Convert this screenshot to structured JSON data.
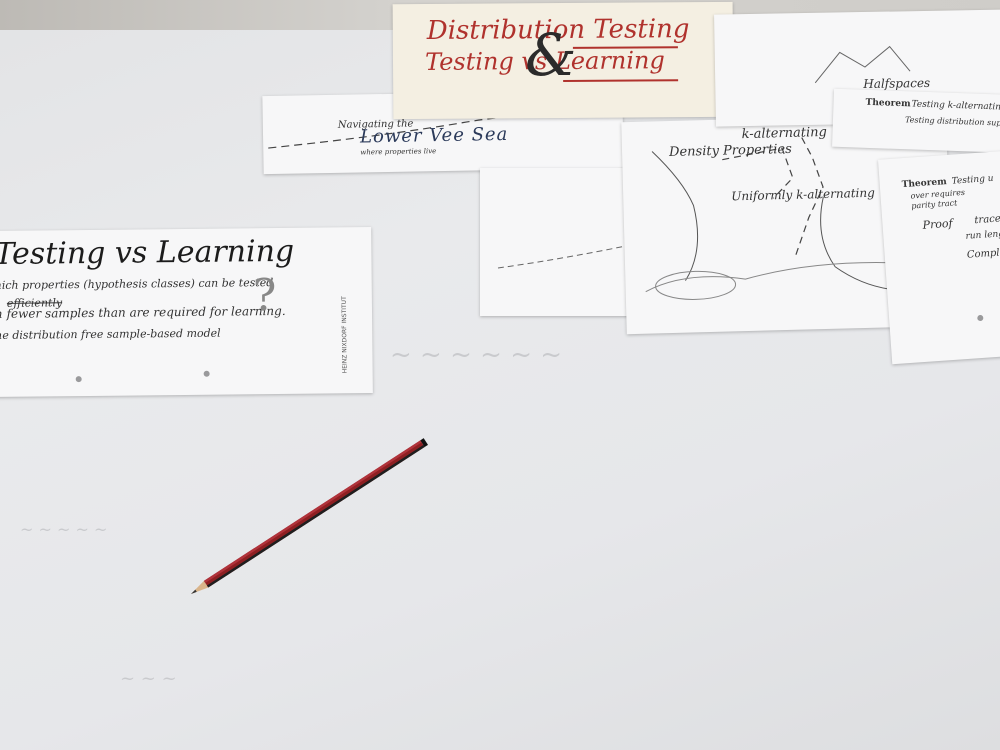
{
  "title_poster": {
    "line1": "Distribution Testing",
    "line2": "Testing vs Learning",
    "ampersand": "&"
  },
  "map_banner": {
    "top_text": "Navigating the",
    "title": "Lower Vee Sea",
    "subtitle": "where properties live"
  },
  "card_left": {
    "title": "Testing vs Learning",
    "line1": "hich properties (hypothesis classes) can be tested",
    "line2_struck": "efficiently",
    "line3": "h fewer samples than are required for learning.",
    "line4": "he distribution free sample-based model",
    "question_mark": "?",
    "side_label": "HEINZ NIXDORF INSTITUT"
  },
  "map_sheet": {
    "label_k_alternating": "k-alternating",
    "label_density": "Density Properties",
    "label_uniformly": "Uniformly k-alternating"
  },
  "halfspaces_sheet": {
    "label": "Halfspaces"
  },
  "theorem_top": {
    "heading": "Theorem",
    "line1": "Testing k-alternating f",
    "line2": "Testing distribution suppo"
  },
  "theorem_right": {
    "heading": "Theorem",
    "line1": "Testing u",
    "line2": "over requires",
    "line3": "parity tract",
    "proof": "Proof",
    "proof_line1": "trace",
    "proof_line2": "run length",
    "proof_line3": "Compl"
  },
  "colors": {
    "table": "#e6e7ea",
    "title_red": "#b0322d",
    "ink": "#333333",
    "pencil_red": "#8e1f22"
  }
}
